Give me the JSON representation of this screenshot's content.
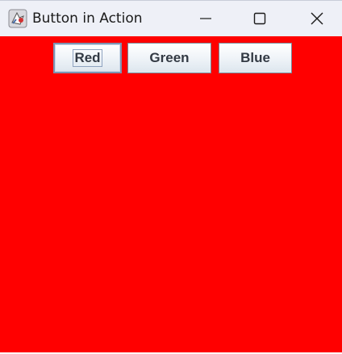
{
  "window": {
    "title": "Button in Action"
  },
  "titlebar_controls": {
    "minimize_icon": "minimize-icon",
    "maximize_icon": "maximize-icon",
    "close_icon": "close-icon"
  },
  "toolbar": {
    "red_label": "Red",
    "green_label": "Green",
    "blue_label": "Blue"
  },
  "panel": {
    "background_color": "#ff0000"
  },
  "colors": {
    "titlebar": "#eef0f7",
    "button_text": "#333a44"
  }
}
